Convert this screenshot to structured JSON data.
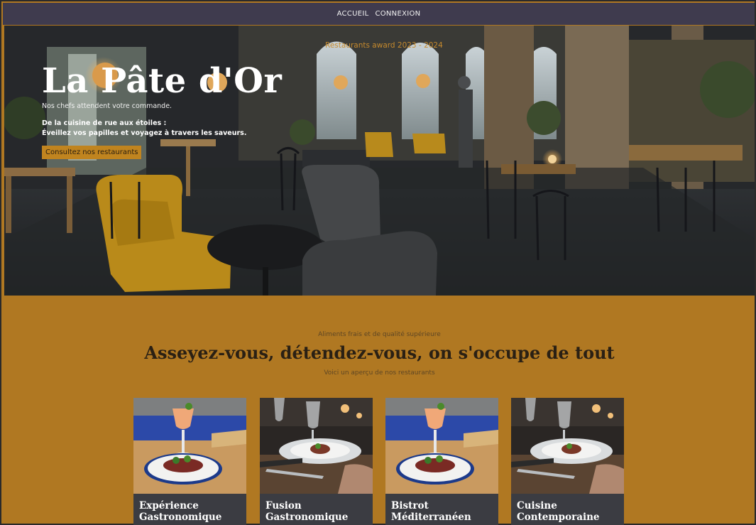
{
  "nav": {
    "items": [
      "ACCUEIL",
      "CONNEXION"
    ]
  },
  "hero": {
    "award": "Restaurants award 2023 - 2024",
    "title": "La Pâte d'Or",
    "subtitle": "Nos chefs attendent votre commande.",
    "line1": "De la cuisine de rue aux étoiles :",
    "line2": "Éveillez vos papilles et voyagez à travers les saveurs.",
    "cta": "Consultez nos restaurants"
  },
  "section": {
    "eyebrow": "Aliments frais et de qualité supérieure",
    "title": "Asseyez-vous, détendez-vous, on s'occupe de tout",
    "subtitle": "Voici un aperçu de nos restaurants"
  },
  "cards": [
    {
      "title": "Expérience Gastronomique"
    },
    {
      "title": "Fusion Gastronomique"
    },
    {
      "title": "Bistrot Méditerranéen"
    },
    {
      "title": "Cuisine Contemporaine"
    }
  ],
  "colors": {
    "nav_bg": "#3f3b4e",
    "accent": "#c0841f",
    "section_bg": "#b07822",
    "card_bg": "#3b3c42"
  }
}
